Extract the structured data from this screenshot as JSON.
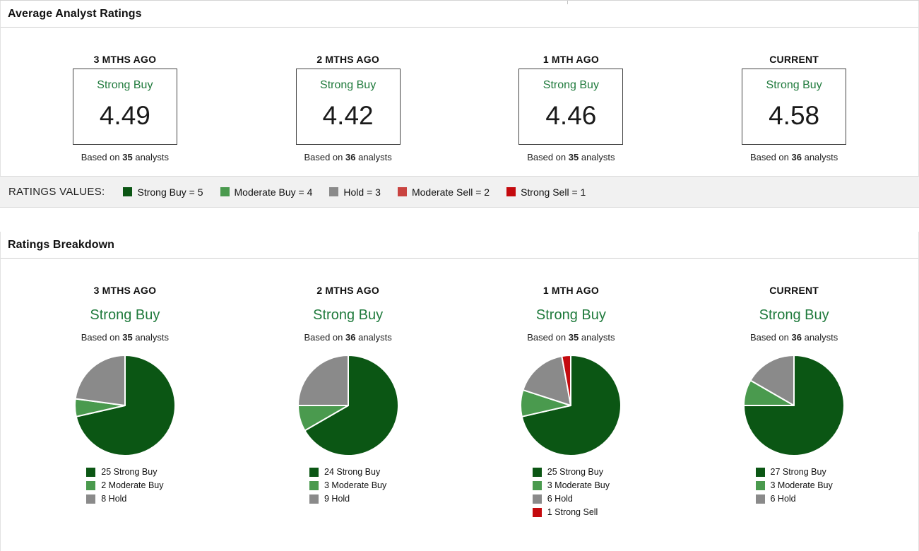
{
  "colors": {
    "strong_buy": "#0b5614",
    "moderate_buy": "#4a9a4e",
    "hold": "#8a8a8a",
    "moderate_sell": "#c94340",
    "strong_sell": "#c40a0e",
    "rating_text_green": "#1f7a3c"
  },
  "avg_panel": {
    "title": "Average Analyst Ratings",
    "columns": [
      {
        "period": "3 MTHS AGO",
        "rating": "Strong Buy",
        "value": "4.49",
        "based_prefix": "Based on",
        "analyst_count": "35",
        "based_suffix": "analysts"
      },
      {
        "period": "2 MTHS AGO",
        "rating": "Strong Buy",
        "value": "4.42",
        "based_prefix": "Based on",
        "analyst_count": "36",
        "based_suffix": "analysts"
      },
      {
        "period": "1 MTH AGO",
        "rating": "Strong Buy",
        "value": "4.46",
        "based_prefix": "Based on",
        "analyst_count": "35",
        "based_suffix": "analysts"
      },
      {
        "period": "CURRENT",
        "rating": "Strong Buy",
        "value": "4.58",
        "based_prefix": "Based on",
        "analyst_count": "36",
        "based_suffix": "analysts"
      }
    ]
  },
  "ratings_values": {
    "label": "RATINGS VALUES:",
    "items": [
      {
        "label": "Strong Buy = 5",
        "color": "#0b5614"
      },
      {
        "label": "Moderate Buy = 4",
        "color": "#4a9a4e"
      },
      {
        "label": "Hold = 3",
        "color": "#8a8a8a"
      },
      {
        "label": "Moderate Sell = 2",
        "color": "#c94340"
      },
      {
        "label": "Strong Sell = 1",
        "color": "#c40a0e"
      }
    ]
  },
  "breakdown_panel": {
    "title": "Ratings Breakdown",
    "columns": [
      {
        "period": "3 MTHS AGO",
        "rating": "Strong Buy",
        "based_prefix": "Based on",
        "analyst_count": "35",
        "based_suffix": "analysts",
        "slices": [
          {
            "label": "25 Strong Buy",
            "value": 25,
            "color": "#0b5614"
          },
          {
            "label": "2 Moderate Buy",
            "value": 2,
            "color": "#4a9a4e"
          },
          {
            "label": "8 Hold",
            "value": 8,
            "color": "#8a8a8a"
          }
        ]
      },
      {
        "period": "2 MTHS AGO",
        "rating": "Strong Buy",
        "based_prefix": "Based on",
        "analyst_count": "36",
        "based_suffix": "analysts",
        "slices": [
          {
            "label": "24 Strong Buy",
            "value": 24,
            "color": "#0b5614"
          },
          {
            "label": "3 Moderate Buy",
            "value": 3,
            "color": "#4a9a4e"
          },
          {
            "label": "9 Hold",
            "value": 9,
            "color": "#8a8a8a"
          }
        ]
      },
      {
        "period": "1 MTH AGO",
        "rating": "Strong Buy",
        "based_prefix": "Based on",
        "analyst_count": "35",
        "based_suffix": "analysts",
        "slices": [
          {
            "label": "25 Strong Buy",
            "value": 25,
            "color": "#0b5614"
          },
          {
            "label": "3 Moderate Buy",
            "value": 3,
            "color": "#4a9a4e"
          },
          {
            "label": "6 Hold",
            "value": 6,
            "color": "#8a8a8a"
          },
          {
            "label": "1 Strong Sell",
            "value": 1,
            "color": "#c40a0e"
          }
        ]
      },
      {
        "period": "CURRENT",
        "rating": "Strong Buy",
        "based_prefix": "Based on",
        "analyst_count": "36",
        "based_suffix": "analysts",
        "slices": [
          {
            "label": "27 Strong Buy",
            "value": 27,
            "color": "#0b5614"
          },
          {
            "label": "3 Moderate Buy",
            "value": 3,
            "color": "#4a9a4e"
          },
          {
            "label": "6 Hold",
            "value": 6,
            "color": "#8a8a8a"
          }
        ]
      }
    ]
  },
  "chart_data": [
    {
      "type": "table",
      "title": "Average Analyst Ratings",
      "columns": [
        "3 MTHS AGO",
        "2 MTHS AGO",
        "1 MTH AGO",
        "CURRENT"
      ],
      "rows": [
        [
          "Strong Buy",
          "Strong Buy",
          "Strong Buy",
          "Strong Buy"
        ],
        [
          4.49,
          4.42,
          4.46,
          4.58
        ],
        [
          "Based on 35 analysts",
          "Based on 36 analysts",
          "Based on 35 analysts",
          "Based on 36 analysts"
        ]
      ],
      "legend": [
        "Strong Buy = 5",
        "Moderate Buy = 4",
        "Hold = 3",
        "Moderate Sell = 2",
        "Strong Sell = 1"
      ]
    },
    {
      "type": "pie",
      "title": "3 MTHS AGO — Strong Buy (35 analysts)",
      "labels": [
        "Strong Buy",
        "Moderate Buy",
        "Hold"
      ],
      "values": [
        25,
        2,
        8
      ],
      "colors": [
        "#0b5614",
        "#4a9a4e",
        "#8a8a8a"
      ],
      "legend_position": "bottom"
    },
    {
      "type": "pie",
      "title": "2 MTHS AGO — Strong Buy (36 analysts)",
      "labels": [
        "Strong Buy",
        "Moderate Buy",
        "Hold"
      ],
      "values": [
        24,
        3,
        9
      ],
      "colors": [
        "#0b5614",
        "#4a9a4e",
        "#8a8a8a"
      ],
      "legend_position": "bottom"
    },
    {
      "type": "pie",
      "title": "1 MTH AGO — Strong Buy (35 analysts)",
      "labels": [
        "Strong Buy",
        "Moderate Buy",
        "Hold",
        "Strong Sell"
      ],
      "values": [
        25,
        3,
        6,
        1
      ],
      "colors": [
        "#0b5614",
        "#4a9a4e",
        "#8a8a8a",
        "#c40a0e"
      ],
      "legend_position": "bottom"
    },
    {
      "type": "pie",
      "title": "CURRENT — Strong Buy (36 analysts)",
      "labels": [
        "Strong Buy",
        "Moderate Buy",
        "Hold"
      ],
      "values": [
        27,
        3,
        6
      ],
      "colors": [
        "#0b5614",
        "#4a9a4e",
        "#8a8a8a"
      ],
      "legend_position": "bottom"
    }
  ]
}
